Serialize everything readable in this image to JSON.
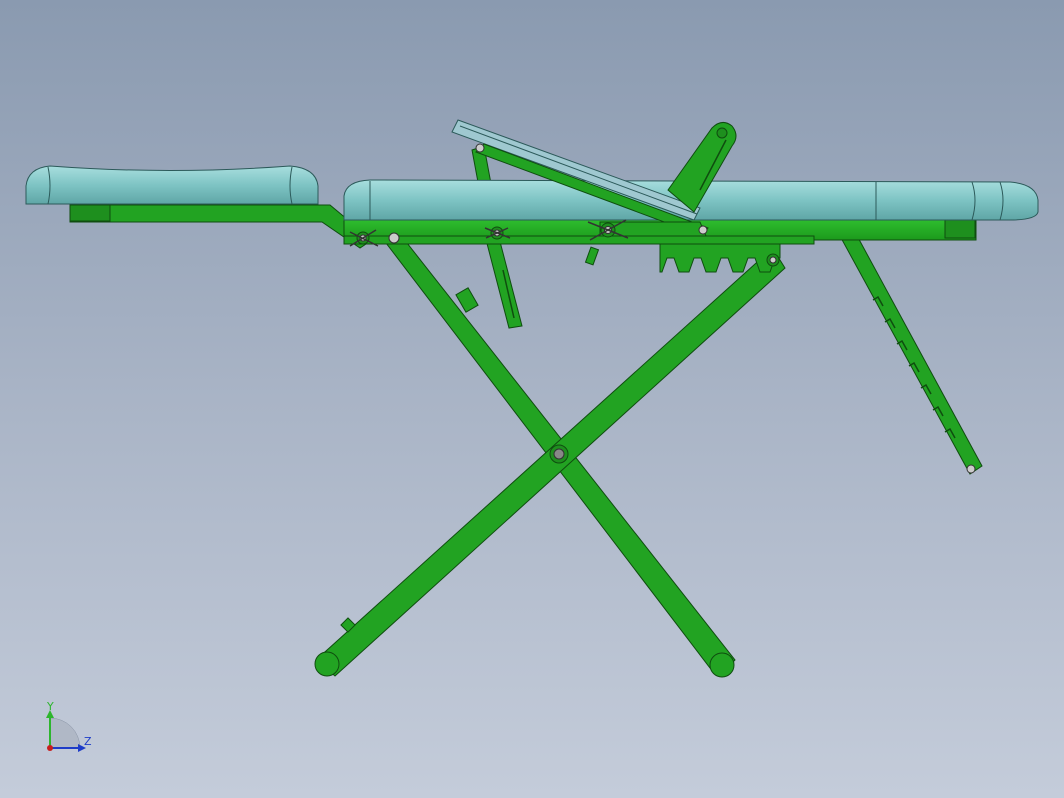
{
  "triad": {
    "y_label": "Y",
    "z_label": "Z",
    "y_color": "#2db52d",
    "z_color": "#1e3cc8",
    "origin_color": "#c81e1e"
  },
  "colors": {
    "frame": "#22a322",
    "frame_edge": "#0f4d0f",
    "cushion": "#7ec4c4",
    "cushion_edge": "#2c5a5a",
    "background_top": "#8a9ab0",
    "background_bottom": "#c4ccda"
  }
}
